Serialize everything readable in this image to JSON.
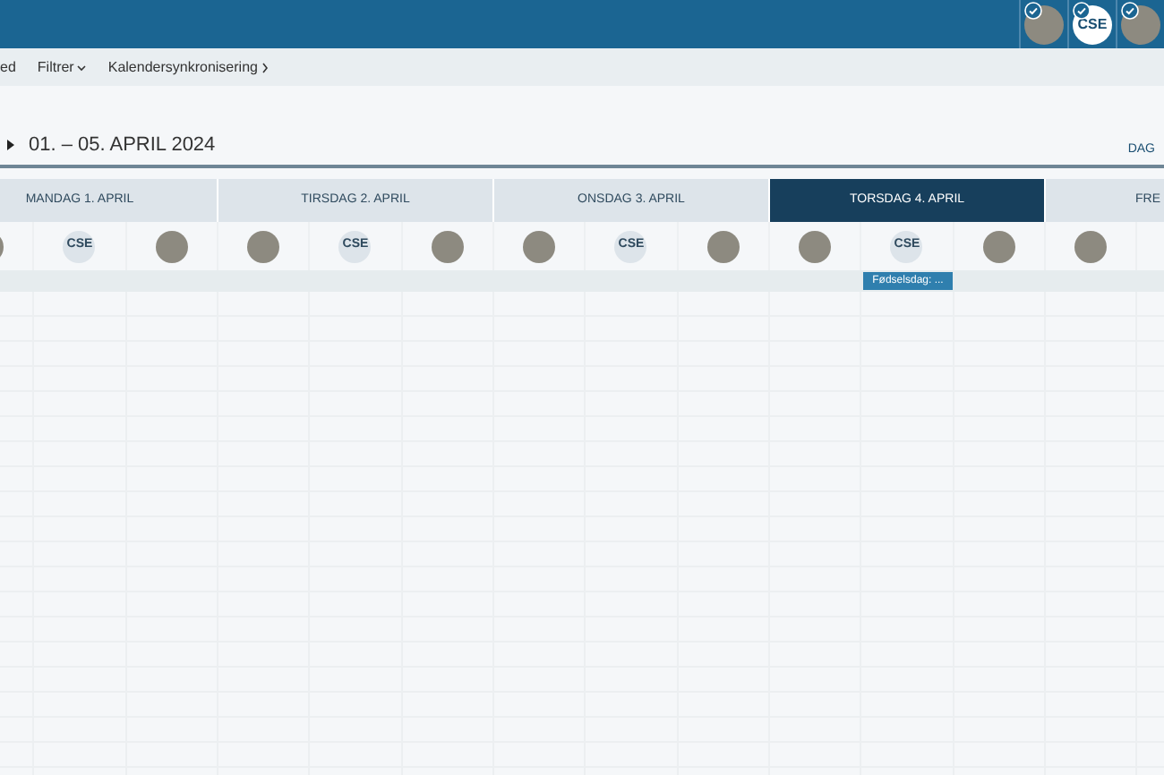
{
  "header": {
    "people": [
      {
        "kind": "photo",
        "checked": true
      },
      {
        "kind": "initials",
        "initials": "CSE",
        "checked": true
      },
      {
        "kind": "photo",
        "checked": true
      }
    ]
  },
  "toolbar": [
    {
      "kind": "text",
      "label": "ed"
    },
    {
      "kind": "dropdown",
      "label": "Filtrer"
    },
    {
      "kind": "link",
      "label": "Kalendersynkronisering"
    }
  ],
  "date_range": "01. – 05. APRIL 2024",
  "view_button": "DAG",
  "days": [
    {
      "label": "MANDAG 1. APRIL",
      "selected": false,
      "people": [
        {
          "kind": "photo"
        },
        {
          "kind": "initials",
          "initials": "CSE"
        },
        {
          "kind": "photo"
        }
      ]
    },
    {
      "label": "TIRSDAG 2. APRIL",
      "selected": false,
      "people": [
        {
          "kind": "photo"
        },
        {
          "kind": "initials",
          "initials": "CSE"
        },
        {
          "kind": "photo"
        }
      ]
    },
    {
      "label": "ONSDAG 3. APRIL",
      "selected": false,
      "people": [
        {
          "kind": "photo"
        },
        {
          "kind": "initials",
          "initials": "CSE"
        },
        {
          "kind": "photo"
        }
      ]
    },
    {
      "label": "TORSDAG 4. APRIL",
      "selected": true,
      "people": [
        {
          "kind": "photo"
        },
        {
          "kind": "initials",
          "initials": "CSE"
        },
        {
          "kind": "photo"
        }
      ],
      "all_day_event": {
        "title": "Fødselsdag: ..."
      }
    },
    {
      "label": "FRE",
      "selected": false,
      "people": [
        {
          "kind": "photo"
        }
      ]
    }
  ]
}
